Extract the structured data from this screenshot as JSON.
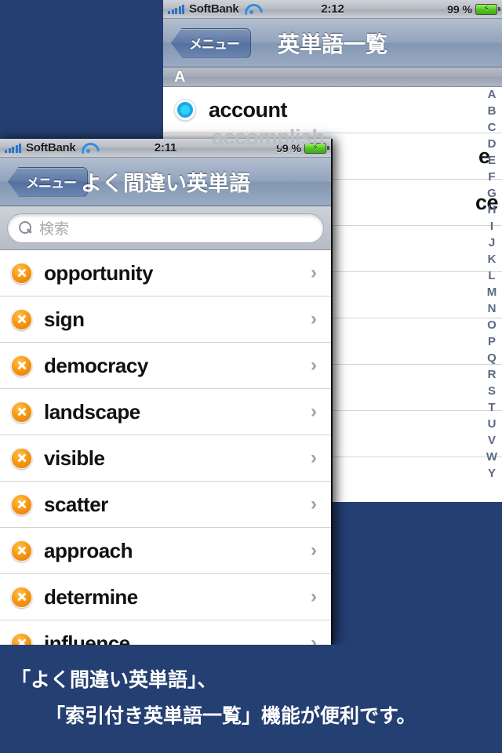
{
  "background_color": "#243f72",
  "back_window": {
    "status_bar": {
      "carrier": "SoftBank",
      "signal_icon": "signal-bars-icon",
      "wifi_icon": "wifi-icon",
      "time": "2:12",
      "battery_percent": "99 %",
      "battery_icon": "battery-charging-icon"
    },
    "nav": {
      "back_label": "メニュー",
      "title": "英単語一覧"
    },
    "ghost_word": "accomplish",
    "section_header": "A",
    "rows": [
      {
        "label": "account",
        "icon": "blue-circle-icon"
      },
      {
        "label": "e",
        "icon": "none"
      },
      {
        "label": "ce",
        "icon": "none"
      }
    ],
    "index_letters": [
      "A",
      "B",
      "C",
      "D",
      "E",
      "F",
      "G",
      "H",
      "I",
      "J",
      "K",
      "L",
      "M",
      "N",
      "O",
      "P",
      "Q",
      "R",
      "S",
      "T",
      "U",
      "V",
      "W",
      "Y"
    ]
  },
  "front_window": {
    "status_bar": {
      "carrier": "SoftBank",
      "signal_icon": "signal-bars-icon",
      "wifi_icon": "wifi-icon",
      "time": "2:11",
      "battery_percent": "99 %",
      "battery_icon": "battery-charging-icon"
    },
    "nav": {
      "back_label": "メニュー",
      "title": "よく間違い英単語"
    },
    "search": {
      "placeholder": "検索",
      "value": "",
      "icon": "search-icon"
    },
    "rows": [
      {
        "label": "opportunity",
        "icon": "orange-x-icon",
        "chevron": "›"
      },
      {
        "label": "sign",
        "icon": "orange-x-icon",
        "chevron": "›"
      },
      {
        "label": "democracy",
        "icon": "orange-x-icon",
        "chevron": "›"
      },
      {
        "label": "landscape",
        "icon": "orange-x-icon",
        "chevron": "›"
      },
      {
        "label": "visible",
        "icon": "orange-x-icon",
        "chevron": "›"
      },
      {
        "label": "scatter",
        "icon": "orange-x-icon",
        "chevron": "›"
      },
      {
        "label": "approach",
        "icon": "orange-x-icon",
        "chevron": "›"
      },
      {
        "label": "determine",
        "icon": "orange-x-icon",
        "chevron": "›"
      },
      {
        "label": "influence",
        "icon": "orange-x-icon",
        "chevron": "›"
      }
    ]
  },
  "caption": {
    "line1": "「よく間違い英単語」、",
    "line2": "「索引付き英単語一覧」機能が便利です。"
  }
}
